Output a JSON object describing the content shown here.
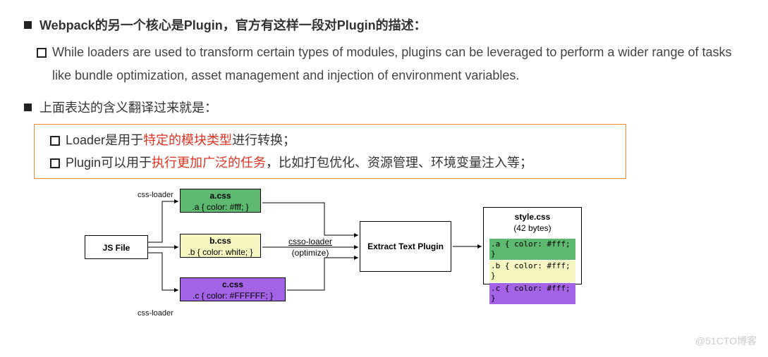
{
  "heading1_pre": "Webpack的另一个核心是Plugin，官方有这样一段对Plugin的描述：",
  "quote": "While loaders are used to transform certain types of modules, plugins can be leveraged to perform a wider range of tasks like bundle optimization, asset management and injection of environment variables.",
  "heading2": "上面表达的含义翻译过来就是：",
  "point1_a": "Loader是用于",
  "point1_red": "特定的模块类型",
  "point1_b": "进行转换；",
  "point2_a": "Plugin可以用于",
  "point2_red": "执行更加广泛的任务",
  "point2_b": "，比如打包优化、资源管理、环境变量注入等；",
  "diagram": {
    "jsfile": "JS File",
    "label_top": "css-loader",
    "label_bot": "css-loader",
    "a_name": "a.css",
    "a_rule": ".a {  color: #fff; }",
    "b_name": "b.css",
    "b_rule": ".b {  color: white; }",
    "c_name": "c.css",
    "c_rule": ".c { color: #FFFFFF; }",
    "csso_top": "csso-loader",
    "csso_bot": "(optimize)",
    "extract": "Extract Text Plugin",
    "style_name": "style.css",
    "style_size": "(42 bytes)",
    "out_a": ".a {  color: #fff; }",
    "out_b": ".b {  color: #fff; }",
    "out_c": ".c {  color: #fff; }"
  },
  "watermark": "@51CTO博客"
}
